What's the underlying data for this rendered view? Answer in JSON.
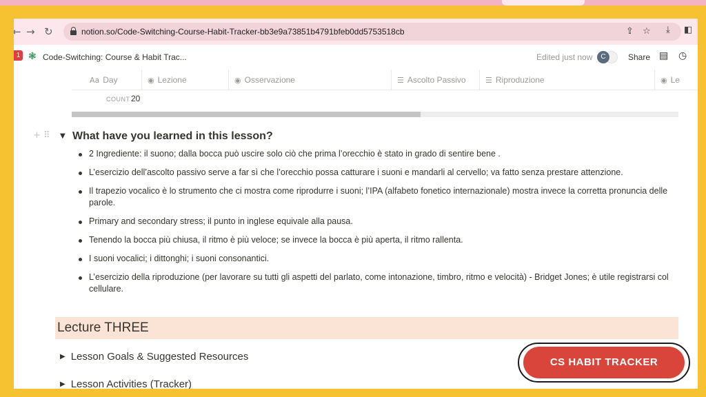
{
  "browser": {
    "back_icon": "back-arrow-icon",
    "forward_icon": "forward-arrow-icon",
    "reload_icon": "reload-icon",
    "url": "notion.so/Code-Switching-Course-Habit-Tracker-bb3e9a73851b4791bfeb0dd5753518cb"
  },
  "notion_bar": {
    "notification_count": "1",
    "page_title": "Code-Switching: Course & Habit Trac...",
    "edited": "Edited just now",
    "avatar_letter": "C",
    "share_label": "Share"
  },
  "table": {
    "columns": [
      {
        "icon": "Aa",
        "label": "Day"
      },
      {
        "icon": "◉",
        "label": "Lezione"
      },
      {
        "icon": "◉",
        "label": "Osservazione"
      },
      {
        "icon": "☰",
        "label": "Ascolto Passivo"
      },
      {
        "icon": "☰",
        "label": "Riproduzione"
      },
      {
        "icon": "◉",
        "label": "Le"
      }
    ],
    "count_label": "COUNT",
    "count_value": "20"
  },
  "section": {
    "heading": "What have you learned in this lesson?",
    "bullets": [
      "2 Ingrediente: il suono; dalla bocca può uscire solo ciò che prima l’orecchio è stato in grado di sentire bene .",
      "L’esercizio dell’ascolto passivo serve a far sì che l’orecchio possa catturare i suoni e mandarli al cervello; va fatto senza prestare attenzione.",
      "Il trapezio vocalico è lo strumento che ci mostra come riprodurre i suoni; l’IPA (alfabeto fonetico internazionale) mostra invece la corretta pronuncia delle parole.",
      "Primary and secondary stress; il punto in inglese equivale alla pausa.",
      "Tenendo la bocca più chiusa, il ritmo è più veloce; se invece la bocca è più aperta, il ritmo rallenta.",
      "I suoni vocalici; i dittonghi; i suoni consonantici.",
      "L’esercizio della riproduzione (per lavorare su tutti gli aspetti del parlato, come intonazione, timbro, ritmo e velocità) - Bridget Jones; è utile registrarsi col cellulare."
    ]
  },
  "lecture": {
    "title": "Lecture THREE",
    "toggles": [
      "Lesson Goals & Suggested Resources",
      "Lesson Activities (Tracker)"
    ]
  },
  "cta": {
    "label": "CS HABIT TRACKER"
  },
  "colors": {
    "background": "#f7c232",
    "cta": "#d9453a",
    "lecture_bg": "#fbe4d6"
  }
}
